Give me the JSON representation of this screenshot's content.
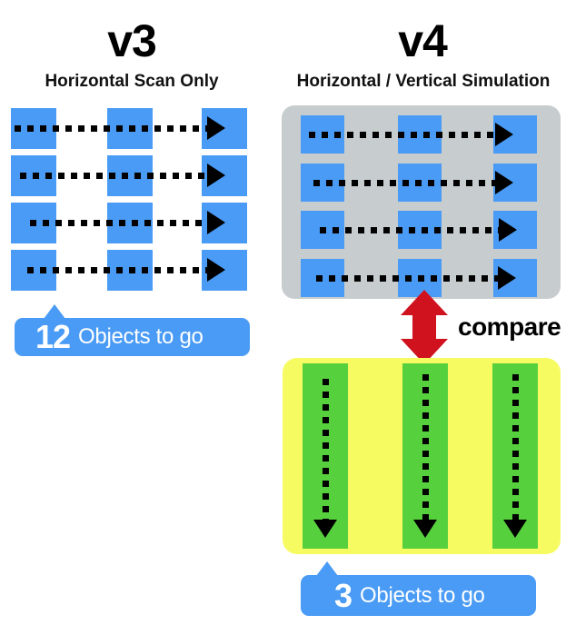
{
  "left_panel": {
    "title": "v3",
    "subtitle": "Horizontal Scan Only",
    "badge": {
      "count": "12",
      "label": "Objects to go"
    },
    "rows": [
      {
        "boxes": 3,
        "scan": "horizontal"
      },
      {
        "boxes": 3,
        "scan": "horizontal"
      },
      {
        "boxes": 3,
        "scan": "horizontal"
      },
      {
        "boxes": 3,
        "scan": "horizontal"
      }
    ]
  },
  "right_panel": {
    "title": "v4",
    "subtitle": "Horizontal / Vertical Simulation",
    "badge": {
      "count": "3",
      "label": "Objects to go"
    },
    "horizontal_stage": {
      "rows": 4,
      "boxes_per_row": 3,
      "scan": "horizontal"
    },
    "vertical_stage": {
      "columns": 3,
      "scan": "vertical"
    },
    "compare": {
      "label": "compare"
    }
  },
  "colors": {
    "object_blue": "#4a9bf5",
    "panel_gray": "#c7ccce",
    "panel_yellow": "#f7fb62",
    "column_green": "#57d03e",
    "compare_red": "#d0121f",
    "arrow_black": "#000000",
    "background": "#ffffff"
  },
  "icons": {
    "scan_arrow_right": "right-arrow-icon",
    "scan_arrow_down": "down-arrow-icon",
    "compare_arrow": "double-arrow-vertical-icon"
  }
}
